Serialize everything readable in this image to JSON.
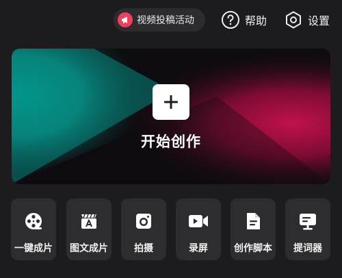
{
  "header": {
    "promo_label": "视频投稿活动",
    "help_label": "帮助",
    "settings_label": "设置"
  },
  "hero": {
    "title": "开始创作",
    "colors": {
      "teal": "#00a79b",
      "crimson": "#c0124a"
    }
  },
  "tools": [
    {
      "label": "一键成片",
      "icon": "film-reel-icon"
    },
    {
      "label": "图文成片",
      "icon": "text-slate-icon"
    },
    {
      "label": "拍摄",
      "icon": "camera-icon"
    },
    {
      "label": "录屏",
      "icon": "screen-record-icon"
    },
    {
      "label": "创作脚本",
      "icon": "document-icon"
    },
    {
      "label": "提词器",
      "icon": "teleprompter-icon"
    }
  ],
  "colors": {
    "background": "#1c1c1e",
    "tile": "#2d2d30",
    "promo_badge": "#f23d5c"
  }
}
